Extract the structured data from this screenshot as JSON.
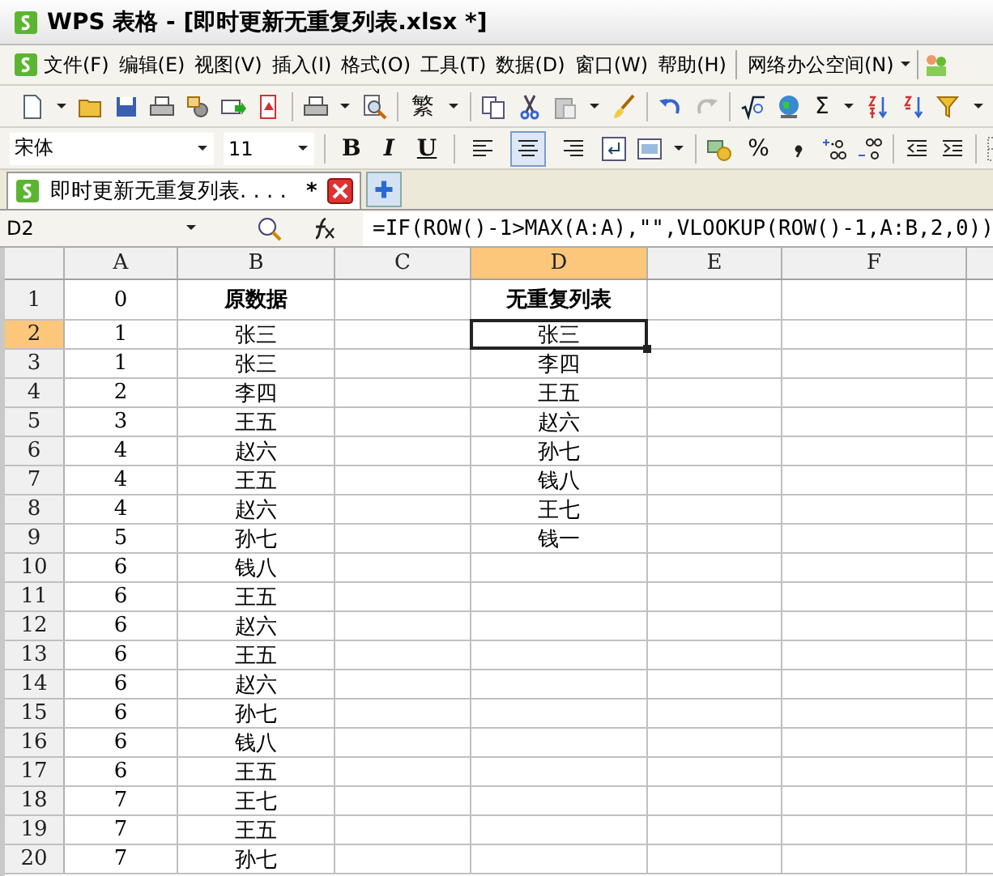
{
  "window": {
    "title": "WPS 表格 - [即时更新无重复列表.xlsx *]"
  },
  "menu": [
    {
      "label": "文件(F)"
    },
    {
      "label": "编辑(E)"
    },
    {
      "label": "视图(V)"
    },
    {
      "label": "插入(I)"
    },
    {
      "label": "格式(O)"
    },
    {
      "label": "工具(T)"
    },
    {
      "label": "数据(D)"
    },
    {
      "label": "窗口(W)"
    },
    {
      "label": "帮助(H)"
    },
    {
      "label": "网络办公空间(N)"
    }
  ],
  "toolbar": {
    "traditional_button": "繁",
    "sum_button": "Σ"
  },
  "format_bar": {
    "font": "宋体",
    "size": "11",
    "bold": "B",
    "italic": "I",
    "underline": "U",
    "percent": "%",
    "alignment": [
      {
        "selected": false
      },
      {
        "selected": true
      },
      {
        "selected": false
      }
    ]
  },
  "tabs": [
    {
      "label": "即时更新无重复列表. . . .",
      "modified": "*",
      "selected": true
    }
  ],
  "formula_bar": {
    "name_box": "D2",
    "formula": "=IF(ROW()-1>MAX(A:A),\"\",VLOOKUP(ROW()-1,A:B,2,0))"
  },
  "grid": {
    "columns": [
      {
        "label": "A",
        "selected": false
      },
      {
        "label": "B",
        "selected": false
      },
      {
        "label": "C",
        "selected": false
      },
      {
        "label": "D",
        "selected": true
      },
      {
        "label": "E",
        "selected": false
      },
      {
        "label": "F",
        "selected": false
      }
    ],
    "rows": [
      {
        "number": "1",
        "kind": "header",
        "selected": false,
        "cells": {
          "A": "0",
          "B": "原数据",
          "D": "无重复列表"
        }
      },
      {
        "number": "2",
        "kind": "data",
        "selected": true,
        "cells": {
          "A": "1",
          "B": "张三",
          "D": "张三"
        }
      },
      {
        "number": "3",
        "kind": "data",
        "selected": false,
        "cells": {
          "A": "1",
          "B": "张三",
          "D": "李四"
        }
      },
      {
        "number": "4",
        "kind": "data",
        "selected": false,
        "cells": {
          "A": "2",
          "B": "李四",
          "D": "王五"
        }
      },
      {
        "number": "5",
        "kind": "data",
        "selected": false,
        "cells": {
          "A": "3",
          "B": "王五",
          "D": "赵六"
        }
      },
      {
        "number": "6",
        "kind": "data",
        "selected": false,
        "cells": {
          "A": "4",
          "B": "赵六",
          "D": "孙七"
        }
      },
      {
        "number": "7",
        "kind": "data",
        "selected": false,
        "cells": {
          "A": "4",
          "B": "王五",
          "D": "钱八"
        }
      },
      {
        "number": "8",
        "kind": "data",
        "selected": false,
        "cells": {
          "A": "4",
          "B": "赵六",
          "D": "王七"
        }
      },
      {
        "number": "9",
        "kind": "data",
        "selected": false,
        "cells": {
          "A": "5",
          "B": "孙七",
          "D": "钱一"
        }
      },
      {
        "number": "10",
        "kind": "data",
        "selected": false,
        "cells": {
          "A": "6",
          "B": "钱八"
        }
      },
      {
        "number": "11",
        "kind": "data",
        "selected": false,
        "cells": {
          "A": "6",
          "B": "王五"
        }
      },
      {
        "number": "12",
        "kind": "data",
        "selected": false,
        "cells": {
          "A": "6",
          "B": "赵六"
        }
      },
      {
        "number": "13",
        "kind": "data",
        "selected": false,
        "cells": {
          "A": "6",
          "B": "王五"
        }
      },
      {
        "number": "14",
        "kind": "data",
        "selected": false,
        "cells": {
          "A": "6",
          "B": "赵六"
        }
      },
      {
        "number": "15",
        "kind": "data",
        "selected": false,
        "cells": {
          "A": "6",
          "B": "孙七"
        }
      },
      {
        "number": "16",
        "kind": "data",
        "selected": false,
        "cells": {
          "A": "6",
          "B": "钱八"
        }
      },
      {
        "number": "17",
        "kind": "data",
        "selected": false,
        "cells": {
          "A": "6",
          "B": "王五"
        }
      },
      {
        "number": "18",
        "kind": "data",
        "selected": false,
        "cells": {
          "A": "7",
          "B": "王七"
        }
      },
      {
        "number": "19",
        "kind": "data",
        "selected": false,
        "cells": {
          "A": "7",
          "B": "王五"
        }
      },
      {
        "number": "20",
        "kind": "data",
        "selected": false,
        "cells": {
          "A": "7",
          "B": "孙七"
        }
      }
    ]
  }
}
